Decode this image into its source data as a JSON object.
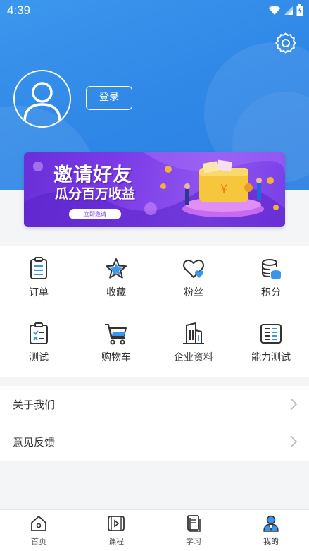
{
  "status_bar": {
    "time": "4:39"
  },
  "header": {
    "login_label": "登录",
    "accent_color": "#3a95ec"
  },
  "banner": {
    "title": "邀请好友",
    "subtitle": "瓜分百万收益",
    "cta": "立即邀请"
  },
  "grid": {
    "items": [
      {
        "label": "订单",
        "icon": "order-icon"
      },
      {
        "label": "收藏",
        "icon": "star-icon"
      },
      {
        "label": "粉丝",
        "icon": "heart-icon"
      },
      {
        "label": "积分",
        "icon": "coins-icon"
      },
      {
        "label": "测试",
        "icon": "checklist-icon"
      },
      {
        "label": "购物车",
        "icon": "cart-icon"
      },
      {
        "label": "企业资料",
        "icon": "building-icon"
      },
      {
        "label": "能力测试",
        "icon": "ability-test-icon"
      }
    ]
  },
  "list": {
    "items": [
      {
        "label": "关于我们"
      },
      {
        "label": "意见反馈"
      }
    ]
  },
  "tabbar": {
    "tabs": [
      {
        "label": "首页",
        "icon": "home-icon"
      },
      {
        "label": "课程",
        "icon": "video-icon"
      },
      {
        "label": "学习",
        "icon": "book-icon"
      },
      {
        "label": "我的",
        "icon": "user-icon"
      }
    ],
    "active_index": 3
  }
}
